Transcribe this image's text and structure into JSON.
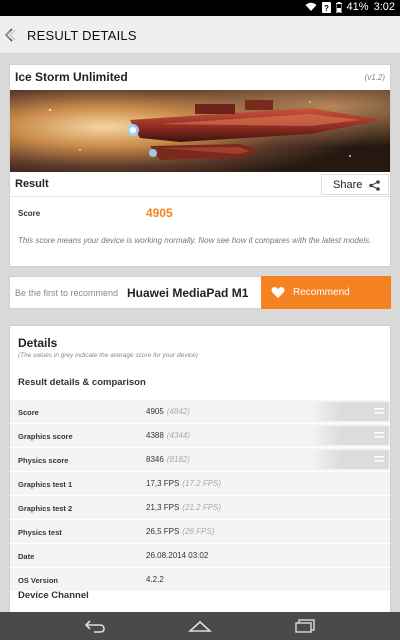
{
  "status": {
    "battery": "41%",
    "time": "3:02"
  },
  "header": {
    "title": "RESULT DETAILS"
  },
  "benchmark": {
    "name": "Ice Storm Unlimited",
    "version": "(v1.2)"
  },
  "result": {
    "label": "Result",
    "share_label": "Share",
    "score_label": "Score",
    "score_value": "4905",
    "description": "This score means your device is working normally. Now see how it compares with the latest models."
  },
  "recommend": {
    "lead": "Be the first to recommend",
    "device": "Huawei MediaPad M1",
    "button_label": "Recommend"
  },
  "details": {
    "heading": "Details",
    "note": "(The values in grey indicate the average score for your device)",
    "subheading": "Result details & comparison",
    "rows": [
      {
        "label": "Score",
        "value": "4905",
        "avg": "(4842)"
      },
      {
        "label": "Graphics score",
        "value": "4388",
        "avg": "(4344)"
      },
      {
        "label": "Physics score",
        "value": "8346",
        "avg": "(8182)"
      },
      {
        "label": "Graphics test 1",
        "value": "17,3 FPS",
        "avg": "(17.2 FPS)"
      },
      {
        "label": "Graphics test 2",
        "value": "21,3 FPS",
        "avg": "(21.2 FPS)"
      },
      {
        "label": "Physics test",
        "value": "26,5 FPS",
        "avg": "(26 FPS)"
      },
      {
        "label": "Date",
        "value": "26.08.2014 03:02",
        "avg": ""
      },
      {
        "label": "OS Version",
        "value": "4.2.2",
        "avg": ""
      }
    ],
    "channel_label": "Device Channel"
  },
  "colors": {
    "accent": "#f58220",
    "status_bar": "#000000",
    "nav_bar": "#4a4a4a"
  },
  "icons": [
    "wifi-icon",
    "signal-icon",
    "battery-icon",
    "back-arrow-icon",
    "share-icon",
    "heart-icon",
    "menu-icon",
    "nav-back-icon",
    "nav-home-icon",
    "nav-recents-icon"
  ]
}
